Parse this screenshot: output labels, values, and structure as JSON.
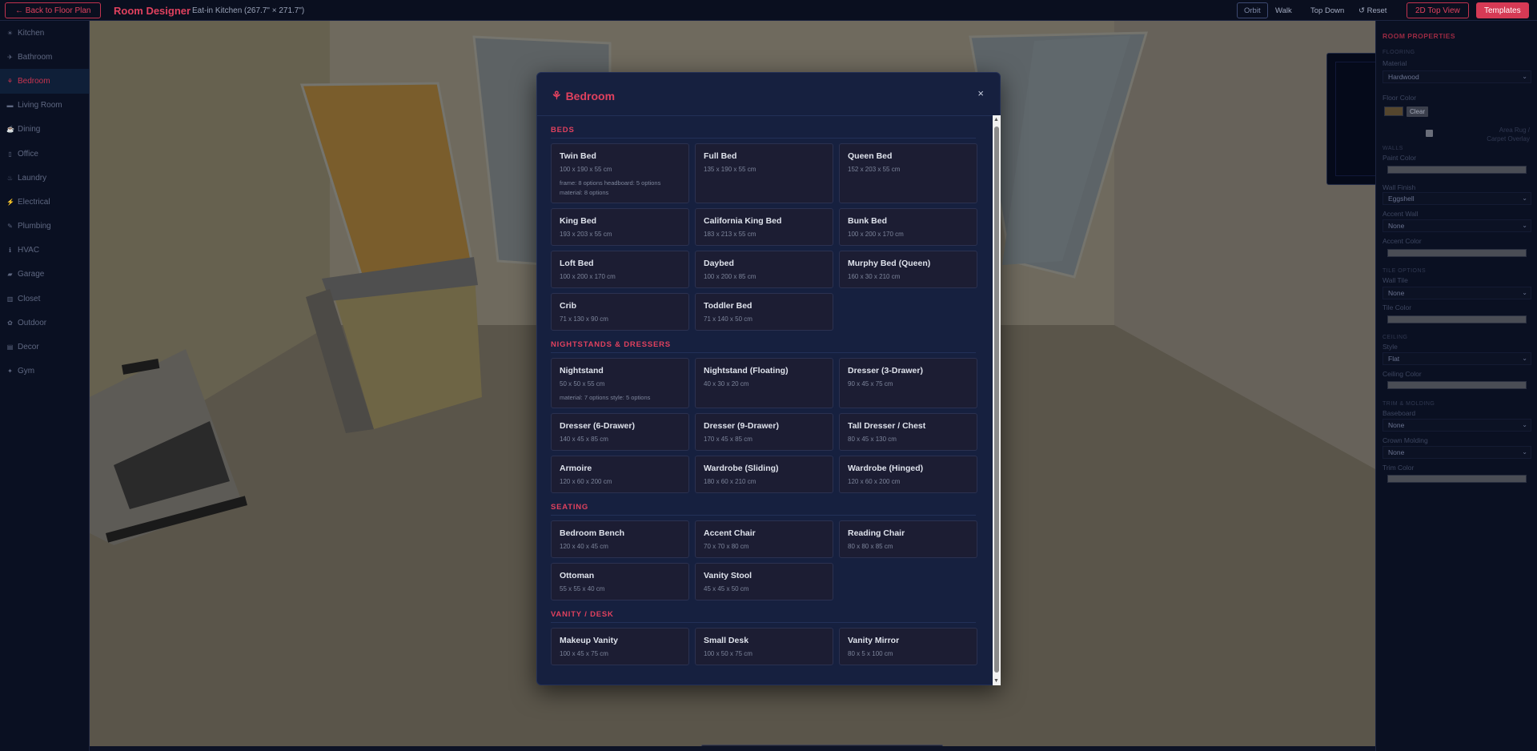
{
  "topbar": {
    "back_label": "← Back to Floor Plan",
    "app_title": "Room Designer",
    "room_name": "Eat-in Kitchen (267.7\" × 271.7\")",
    "view_modes": [
      "Orbit",
      "Walk",
      "Top Down",
      "↺ Reset"
    ],
    "active_view": "Orbit",
    "top_view_label": "2D Top View",
    "templates_label": "Templates"
  },
  "sidebar": {
    "active": "Bedroom",
    "items": [
      {
        "icon": "☀",
        "label": "Kitchen"
      },
      {
        "icon": "✈",
        "label": "Bathroom"
      },
      {
        "icon": "⚘",
        "label": "Bedroom"
      },
      {
        "icon": "▬",
        "label": "Living Room"
      },
      {
        "icon": "☕",
        "label": "Dining"
      },
      {
        "icon": "▯",
        "label": "Office"
      },
      {
        "icon": "♨",
        "label": "Laundry"
      },
      {
        "icon": "⚡",
        "label": "Electrical"
      },
      {
        "icon": "✎",
        "label": "Plumbing"
      },
      {
        "icon": "ℹ",
        "label": "HVAC"
      },
      {
        "icon": "▰",
        "label": "Garage"
      },
      {
        "icon": "▥",
        "label": "Closet"
      },
      {
        "icon": "✿",
        "label": "Outdoor"
      },
      {
        "icon": "▤",
        "label": "Decor"
      },
      {
        "icon": "✦",
        "label": "Gym"
      }
    ]
  },
  "properties": {
    "title": "ROOM PROPERTIES",
    "flooring_section": "FLOORING",
    "material_label": "Material",
    "material_value": "Hardwood",
    "floor_color_label": "Floor Color",
    "clear_label": "Clear",
    "rug_label": "Area Rug / Carpet Overlay",
    "walls_section": "WALLS",
    "paint_color_label": "Paint Color",
    "wall_finish_label": "Wall Finish",
    "wall_finish_value": "Eggshell",
    "accent_wall_label": "Accent Wall",
    "accent_wall_value": "None",
    "accent_color_label": "Accent Color",
    "tile_section": "TILE OPTIONS",
    "wall_tile_label": "Wall Tile",
    "wall_tile_value": "None",
    "tile_color_label": "Tile Color",
    "ceiling_section": "CEILING",
    "style_label": "Style",
    "style_value": "Flat",
    "ceiling_color_label": "Ceiling Color",
    "trim_section": "TRIM & MOLDING",
    "baseboard_label": "Baseboard",
    "baseboard_value": "None",
    "crown_label": "Crown Molding",
    "crown_value": "None",
    "trim_color_label": "Trim Color"
  },
  "modal": {
    "icon": "⚘",
    "title": "Bedroom",
    "close": "×",
    "categories": [
      {
        "title": "BEDS",
        "items": [
          {
            "name": "Twin Bed",
            "dims": "100 x 190 x 55 cm",
            "options": "frame: 8 options headboard: 5 options material: 8 options"
          },
          {
            "name": "Full Bed",
            "dims": "135 x 190 x 55 cm"
          },
          {
            "name": "Queen Bed",
            "dims": "152 x 203 x 55 cm"
          },
          {
            "name": "King Bed",
            "dims": "193 x 203 x 55 cm"
          },
          {
            "name": "California King Bed",
            "dims": "183 x 213 x 55 cm"
          },
          {
            "name": "Bunk Bed",
            "dims": "100 x 200 x 170 cm"
          },
          {
            "name": "Loft Bed",
            "dims": "100 x 200 x 170 cm"
          },
          {
            "name": "Daybed",
            "dims": "100 x 200 x 85 cm"
          },
          {
            "name": "Murphy Bed (Queen)",
            "dims": "160 x 30 x 210 cm"
          },
          {
            "name": "Crib",
            "dims": "71 x 130 x 90 cm"
          },
          {
            "name": "Toddler Bed",
            "dims": "71 x 140 x 50 cm"
          }
        ]
      },
      {
        "title": "NIGHTSTANDS & DRESSERS",
        "items": [
          {
            "name": "Nightstand",
            "dims": "50 x 50 x 55 cm",
            "options": "material: 7 options style: 5 options"
          },
          {
            "name": "Nightstand (Floating)",
            "dims": "40 x 30 x 20 cm"
          },
          {
            "name": "Dresser (3-Drawer)",
            "dims": "90 x 45 x 75 cm"
          },
          {
            "name": "Dresser (6-Drawer)",
            "dims": "140 x 45 x 85 cm"
          },
          {
            "name": "Dresser (9-Drawer)",
            "dims": "170 x 45 x 85 cm"
          },
          {
            "name": "Tall Dresser / Chest",
            "dims": "80 x 45 x 130 cm"
          },
          {
            "name": "Armoire",
            "dims": "120 x 60 x 200 cm"
          },
          {
            "name": "Wardrobe (Sliding)",
            "dims": "180 x 60 x 210 cm"
          },
          {
            "name": "Wardrobe (Hinged)",
            "dims": "120 x 60 x 200 cm"
          }
        ]
      },
      {
        "title": "SEATING",
        "items": [
          {
            "name": "Bedroom Bench",
            "dims": "120 x 40 x 45 cm"
          },
          {
            "name": "Accent Chair",
            "dims": "70 x 70 x 80 cm"
          },
          {
            "name": "Reading Chair",
            "dims": "80 x 80 x 85 cm"
          },
          {
            "name": "Ottoman",
            "dims": "55 x 55 x 40 cm"
          },
          {
            "name": "Vanity Stool",
            "dims": "45 x 45 x 50 cm"
          }
        ]
      },
      {
        "title": "VANITY / DESK",
        "items": [
          {
            "name": "Makeup Vanity",
            "dims": "100 x 45 x 75 cm"
          },
          {
            "name": "Small Desk",
            "dims": "100 x 50 x 75 cm"
          },
          {
            "name": "Vanity Mirror",
            "dims": "80 x 5 x 100 cm"
          }
        ]
      }
    ]
  },
  "colors": {
    "accent": "#e0415e",
    "background": "#0d1326",
    "modal_bg": "#16203f",
    "card_bg": "#1c1d33"
  }
}
